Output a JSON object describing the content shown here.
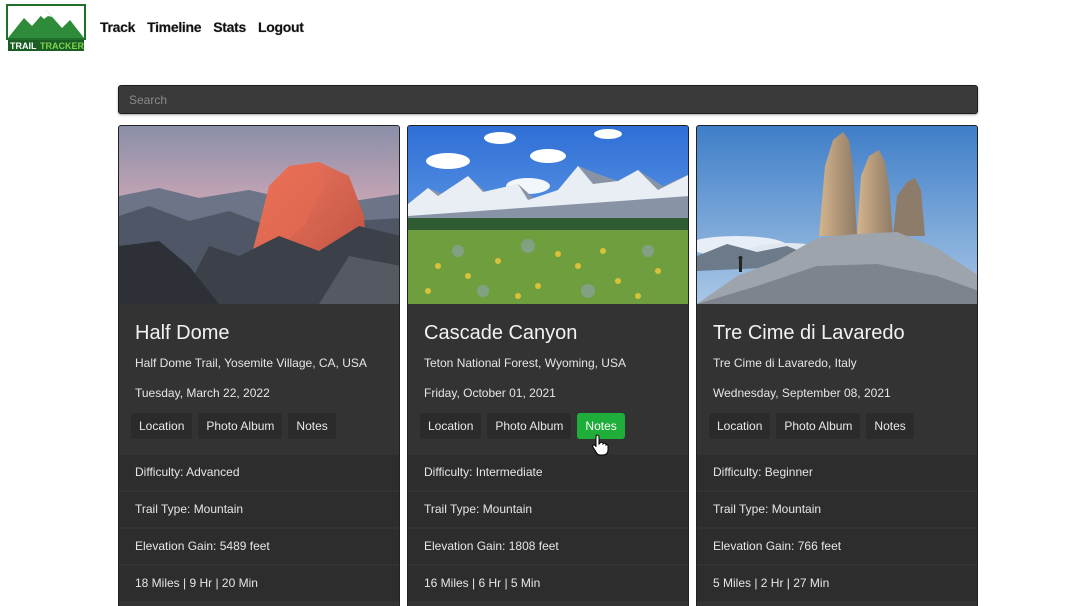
{
  "app": {
    "logo_text_1": "TRAIL",
    "logo_text_2": "TRACKER"
  },
  "nav": [
    {
      "label": "Track"
    },
    {
      "label": "Timeline"
    },
    {
      "label": "Stats"
    },
    {
      "label": "Logout"
    }
  ],
  "search": {
    "placeholder": "Search",
    "value": ""
  },
  "cards": [
    {
      "title": "Half Dome",
      "location": "Half Dome Trail, Yosemite Village, CA, USA",
      "date": "Tuesday, March 22, 2022",
      "buttons": [
        "Location",
        "Photo Album",
        "Notes"
      ],
      "difficulty": "Difficulty: Advanced",
      "trail_type": "Trail Type: Mountain",
      "elevation": "Elevation Gain: 5489 feet",
      "duration": "18 Miles | 9 Hr | 20 Min"
    },
    {
      "title": "Cascade Canyon",
      "location": "Teton National Forest, Wyoming, USA",
      "date": "Friday, October 01, 2021",
      "buttons": [
        "Location",
        "Photo Album",
        "Notes"
      ],
      "difficulty": "Difficulty: Intermediate",
      "trail_type": "Trail Type: Mountain",
      "elevation": "Elevation Gain: 1808 feet",
      "duration": "16 Miles | 6 Hr | 5 Min"
    },
    {
      "title": "Tre Cime di Lavaredo",
      "location": "Tre Cime di Lavaredo, Italy",
      "date": "Wednesday, September 08, 2021",
      "buttons": [
        "Location",
        "Photo Album",
        "Notes"
      ],
      "difficulty": "Difficulty: Beginner",
      "trail_type": "Trail Type: Mountain",
      "elevation": "Elevation Gain: 766 feet",
      "duration": "5 Miles | 2 Hr | 27 Min"
    }
  ],
  "colors": {
    "card_bg": "#333333",
    "stat_row_bg": "#2d2d2d",
    "active_button": "#1fae3a",
    "logo_green": "#2e8b3a"
  },
  "active_button": {
    "card": 1,
    "label": "Notes"
  }
}
